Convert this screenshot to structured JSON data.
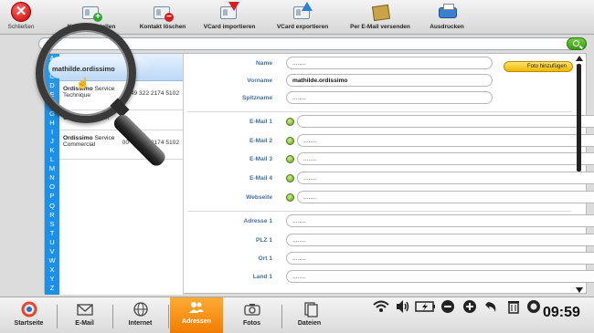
{
  "window": {
    "close_label": "Schließen"
  },
  "toolbar": {
    "items": [
      {
        "label": "Kontakt erstellen",
        "icon": "add-contact-icon"
      },
      {
        "label": "Kontakt löschen",
        "icon": "delete-contact-icon"
      },
      {
        "label": "VCard importieren",
        "icon": "vcard-import-icon"
      },
      {
        "label": "VCard exportieren",
        "icon": "vcard-export-icon"
      },
      {
        "label": "Per E-Mail versenden",
        "icon": "send-email-icon"
      },
      {
        "label": "Ausdrucken",
        "icon": "printer-icon"
      }
    ]
  },
  "search": {
    "placeholder": ""
  },
  "alphabet": [
    "A",
    "B",
    "C",
    "D",
    "E",
    "F",
    "G",
    "H",
    "I",
    "J",
    "K",
    "L",
    "M",
    "N",
    "O",
    "P",
    "Q",
    "R",
    "S",
    "T",
    "U",
    "V",
    "W",
    "X",
    "Y",
    "Z"
  ],
  "contacts": [
    {
      "name": "mathilde.ordissimo",
      "sub": "",
      "phone": "",
      "selected": true
    },
    {
      "name": "Ordissimo",
      "sub_inline": "Service",
      "sub": "Technique",
      "phone": "00 49 322 2174 5102",
      "selected": false
    },
    {
      "name": "Ordissimo",
      "sub_inline": "Bonn",
      "sub": "",
      "phone": "",
      "selected": false
    },
    {
      "name": "Ordissimo",
      "sub_inline": "Service",
      "sub": "Commercial",
      "phone": "00 49 322 2174 5102",
      "selected": false
    }
  ],
  "form": {
    "name": {
      "label": "Name",
      "value": "........"
    },
    "vorname": {
      "label": "Vorname",
      "value": "mathilde.ordissimo"
    },
    "spitzname": {
      "label": "Spitzname",
      "value": "........"
    },
    "photo_button": "Foto hinzufügen",
    "email1": {
      "label": "E-Mail 1",
      "value": ""
    },
    "email2": {
      "label": "E-Mail 2",
      "value": "........"
    },
    "email3": {
      "label": "E-Mail 3",
      "value": "........"
    },
    "email4": {
      "label": "E-Mail 4",
      "value": "........"
    },
    "webseite": {
      "label": "Webseite",
      "value": "........"
    },
    "adresse1": {
      "label": "Adresse 1",
      "value": "........"
    },
    "plz1": {
      "label": "PLZ 1",
      "value": "........"
    },
    "ort1": {
      "label": "Ort 1",
      "value": "........"
    },
    "land1": {
      "label": "Land 1",
      "value": "........"
    }
  },
  "taskbar": {
    "items": [
      {
        "label": "Startseite",
        "icon": "home-logo-icon"
      },
      {
        "label": "E-Mail",
        "icon": "envelope-icon"
      },
      {
        "label": "Internet",
        "icon": "globe-icon"
      },
      {
        "label": "Adressen",
        "icon": "contacts-icon",
        "active": true
      },
      {
        "label": "Fotos",
        "icon": "camera-icon"
      },
      {
        "label": "Dateien",
        "icon": "files-icon"
      }
    ],
    "time": "09:59"
  },
  "colors": {
    "accent": "#1c8fe6",
    "active_tab": "#f08a00",
    "label_blue": "#45719c"
  }
}
